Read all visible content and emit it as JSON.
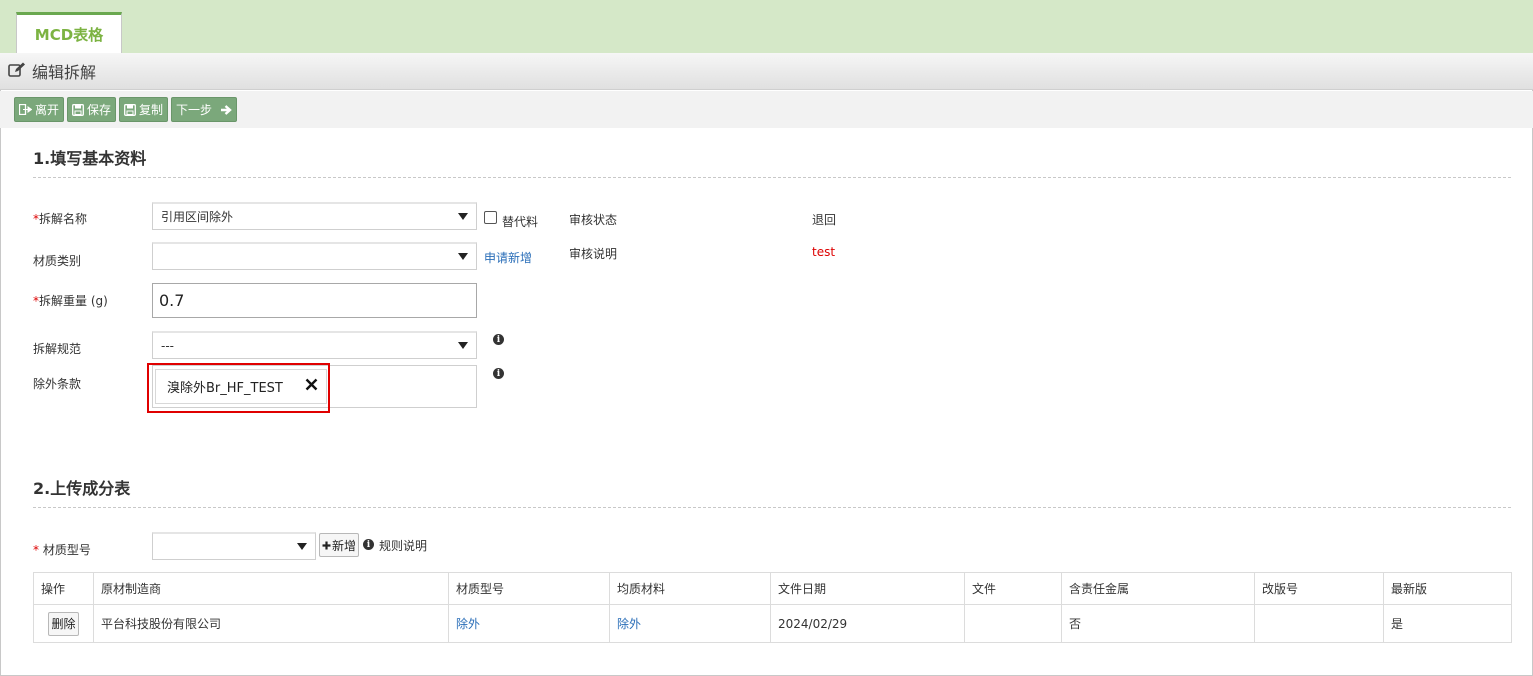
{
  "tab": {
    "label": "MCD表格"
  },
  "header": {
    "title": "编辑拆解"
  },
  "toolbar": {
    "leave_label": "离开",
    "save_label": "保存",
    "copy_label": "复制",
    "next_label": "下一步"
  },
  "section1": {
    "heading": "1.填写基本资料",
    "name_label": "拆解名称",
    "name_value": "引用区间除外",
    "substitute_label": "替代料",
    "material_type_label": "材质类别",
    "material_type_value": "",
    "apply_new_link": "申请新增",
    "weight_label": "拆解重量 (g)",
    "weight_value": "0.7",
    "spec_label": "拆解规范",
    "spec_value": "---",
    "exclusion_label": "除外条款",
    "exclusion_tag": "溴除外Br_HF_TEST",
    "review_status_label": "审核状态",
    "review_status_value": "退回",
    "review_note_label": "审核说明",
    "review_note_value": "test"
  },
  "section2": {
    "heading": "2.上传成分表",
    "model_label": "材质型号",
    "model_value": "",
    "add_button": "新增",
    "rules_link": "规则说明",
    "table": {
      "headers": [
        "操作",
        "原材制造商",
        "材质型号",
        "均质材料",
        "文件日期",
        "文件",
        "含责任金属",
        "改版号",
        "最新版"
      ],
      "rows": [
        {
          "action": "删除",
          "manufacturer": "平台科技股份有限公司",
          "model": "除外",
          "homogeneous": "除外",
          "date": "2024/02/29",
          "file": "",
          "metal": "否",
          "revision": "",
          "latest": "是"
        }
      ]
    }
  },
  "colors": {
    "tab_strip": "#d5e8c8",
    "tab_text": "#7cb342",
    "toolbar_button": "#7ba87b",
    "link": "#2a6eb8",
    "required": "#dd0000",
    "highlight": "#e00000"
  }
}
